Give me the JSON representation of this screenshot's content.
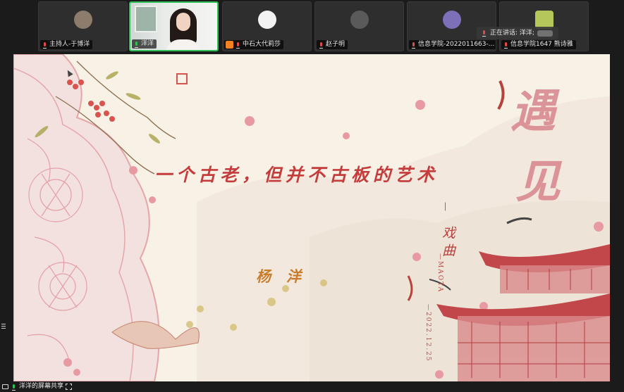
{
  "participants": [
    {
      "name": "主持人-于博洋",
      "video": "avatar",
      "mic": "muted"
    },
    {
      "name": "洋洋",
      "video": "camera",
      "mic": "live",
      "active": true
    },
    {
      "name": "中石大代莉莎",
      "video": "avatar",
      "mic": "muted",
      "badge": "orange-square-icon"
    },
    {
      "name": "赵子明",
      "video": "avatar",
      "mic": "muted"
    },
    {
      "name": "信息学院-2022011663-...",
      "video": "avatar",
      "mic": "muted"
    },
    {
      "name": "信息学院1647 熊诗雅",
      "video": "avatar",
      "mic": "muted"
    }
  ],
  "speaking_indicator": {
    "label": "正在讲话: 洋洋;"
  },
  "slide": {
    "headline": "一个古老，但并不古板的艺术",
    "big_char_1": "遇",
    "big_char_2": "见",
    "dash": "—",
    "genre": "戏曲",
    "author": "杨洋",
    "signature": "—MAOTA",
    "date": "—2022.12.25"
  },
  "share_bar": {
    "label": "洋洋的屏幕共享"
  },
  "colors": {
    "accent_green": "#2fbf57",
    "slide_bg": "#f7f1e6",
    "slide_red": "#c43c3c",
    "blossom": "#e89aa2"
  }
}
